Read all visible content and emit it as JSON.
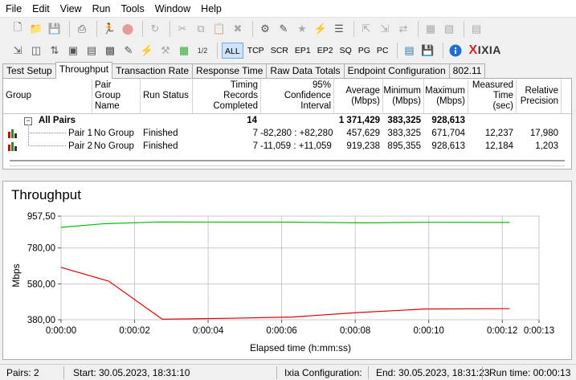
{
  "menu": [
    "File",
    "Edit",
    "View",
    "Run",
    "Tools",
    "Window",
    "Help"
  ],
  "toolbar": {
    "filters": [
      "ALL",
      "TCP",
      "SCR",
      "EP1",
      "EP2",
      "SQ",
      "PG",
      "PC"
    ],
    "active_filter": "ALL",
    "brand": "IXIA",
    "info_icon": "info-icon"
  },
  "tabs": [
    "Test Setup",
    "Throughput",
    "Transaction Rate",
    "Response Time",
    "Raw Data Totals",
    "Endpoint Configuration",
    "802.11"
  ],
  "active_tab": "Throughput",
  "table": {
    "headers": {
      "group": "Group",
      "pair_group_1": "Pair Group",
      "pair_group_2": "Name",
      "run_status": "Run Status",
      "timing_1": "Timing Records",
      "timing_2": "Completed",
      "conf_1": "95% Confidence",
      "conf_2": "Interval",
      "avg_1": "Average",
      "avg_2": "(Mbps)",
      "min_1": "Minimum",
      "min_2": "(Mbps)",
      "max_1": "Maximum",
      "max_2": "(Mbps)",
      "meas_1": "Measured",
      "meas_2": "Time (sec)",
      "rel_1": "Relative",
      "rel_2": "Precision"
    },
    "summary": {
      "expander": "−",
      "label": "All Pairs",
      "timing": "14",
      "average": "1 371,429",
      "minimum": "383,325",
      "maximum": "928,613"
    },
    "rows": [
      {
        "pair": "Pair 1",
        "group": "No Group",
        "status": "Finished",
        "timing": "7",
        "interval": "-82,280 : +82,280",
        "average": "457,629",
        "minimum": "383,325",
        "maximum": "671,704",
        "measured": "12,237",
        "precision": "17,980"
      },
      {
        "pair": "Pair 2",
        "group": "No Group",
        "status": "Finished",
        "timing": "7",
        "interval": "-11,059 : +11,059",
        "average": "919,238",
        "minimum": "895,355",
        "maximum": "928,613",
        "measured": "12,184",
        "precision": "1,203"
      }
    ]
  },
  "chart_title": "Throughput",
  "chart_data": {
    "type": "line",
    "title": "Throughput",
    "xlabel": "Elapsed time (h:mm:ss)",
    "ylabel": "Mbps",
    "xlim": [
      0,
      13
    ],
    "ylim": [
      380.0,
      957.5
    ],
    "x_ticks": [
      {
        "v": 0,
        "label": "0:00:00"
      },
      {
        "v": 2,
        "label": "0:00:02"
      },
      {
        "v": 4,
        "label": "0:00:04"
      },
      {
        "v": 6,
        "label": "0:00:06"
      },
      {
        "v": 8,
        "label": "0:00:08"
      },
      {
        "v": 10,
        "label": "0:00:10"
      },
      {
        "v": 12,
        "label": "0:00:12"
      },
      {
        "v": 13,
        "label": "0:00:13"
      }
    ],
    "y_ticks": [
      {
        "v": 380.0,
        "label": "380,00"
      },
      {
        "v": 580.0,
        "label": "580,00"
      },
      {
        "v": 780.0,
        "label": "780,00"
      },
      {
        "v": 957.5,
        "label": "957,50"
      }
    ],
    "grid": true,
    "series": [
      {
        "color": "#00c000",
        "x": [
          0,
          1.15,
          2.65,
          4.5,
          6.3,
          8.2,
          9.9,
          12.2
        ],
        "y": [
          895,
          915,
          925,
          924,
          924,
          920,
          923,
          922
        ]
      },
      {
        "color": "#e00000",
        "x": [
          0,
          1.3,
          2.75,
          4.6,
          6.3,
          8.05,
          9.9,
          12.2
        ],
        "y": [
          672,
          595,
          383,
          388,
          395,
          420,
          440,
          442
        ]
      }
    ]
  },
  "status": {
    "pairs": "Pairs: 2",
    "start": "Start: 30.05.2023, 18:31:10",
    "ixia": "Ixia Configuration:",
    "end": "End: 30.05.2023, 18:31:23",
    "runtime": "Run time: 00:00:13"
  }
}
